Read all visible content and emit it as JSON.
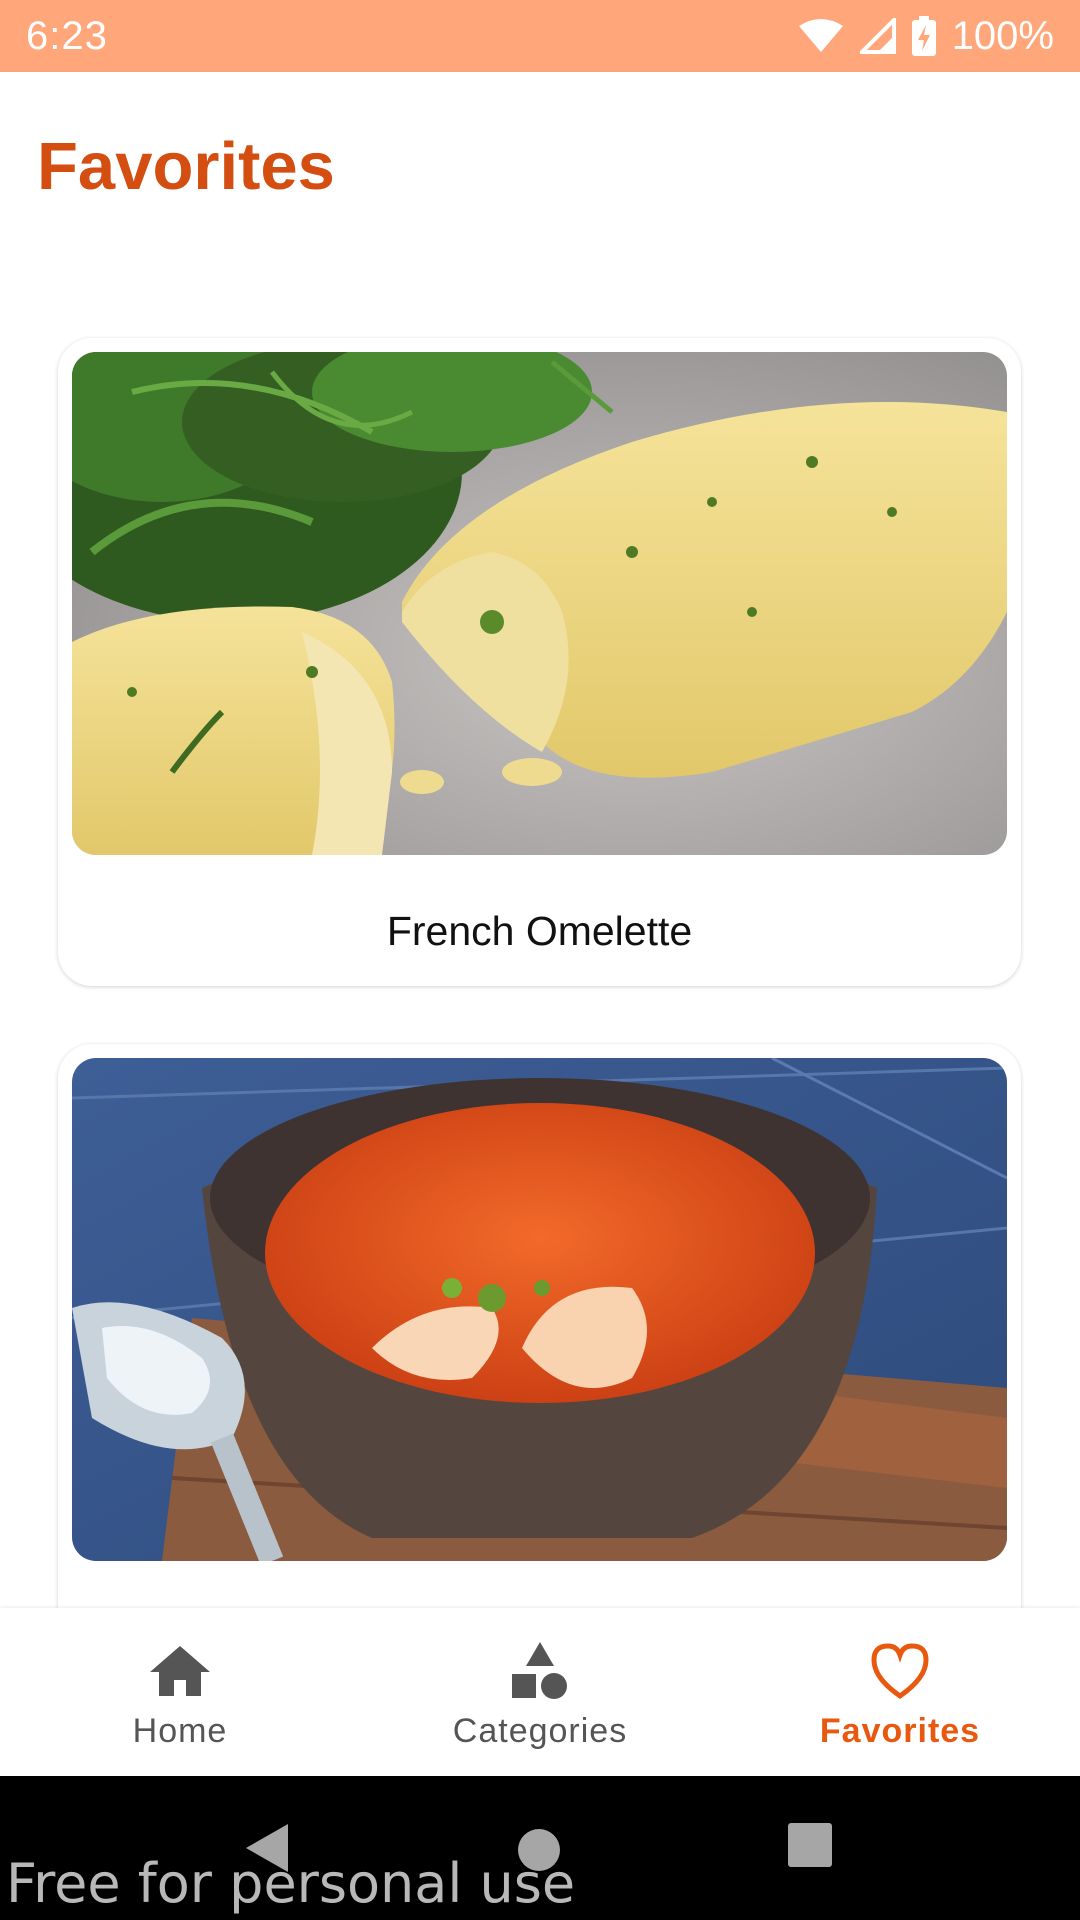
{
  "status_bar": {
    "time": "6:23",
    "battery": "100%",
    "icons": [
      "wifi-icon",
      "cell-signal-icon",
      "battery-charging-icon"
    ]
  },
  "app_bar": {
    "title": "Favorites",
    "title_color": "#d34e10"
  },
  "favorites": [
    {
      "name": "French Omelette",
      "image": "omelette-photo"
    },
    {
      "name": "",
      "image": "tomato-soup-photo"
    }
  ],
  "bottom_nav": {
    "items": [
      {
        "label": "Home",
        "icon": "home-icon",
        "active": false
      },
      {
        "label": "Categories",
        "icon": "categories-icon",
        "active": false
      },
      {
        "label": "Favorites",
        "icon": "heart-icon",
        "active": true
      }
    ],
    "active_color": "#e8590f"
  },
  "system_nav": {
    "buttons": [
      "back-icon",
      "home-circle-icon",
      "recents-icon"
    ]
  },
  "watermark": "Free for personal use"
}
